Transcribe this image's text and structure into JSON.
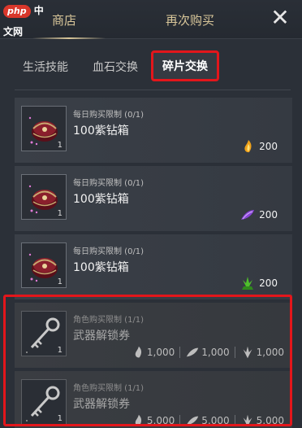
{
  "watermark": "php 中文网",
  "header": {
    "tab_shop": "商店",
    "tab_rebuy": "再次购买",
    "close": "✕"
  },
  "sub_tabs": {
    "life": "生活技能",
    "blood": "血石交换",
    "fragment": "碎片交换"
  },
  "items": [
    {
      "limit": "每日购买限制 (0/1)",
      "name": "100紫钻箱",
      "qty": "1",
      "cost": "200",
      "currency_icon": "gold-flame-icon"
    },
    {
      "limit": "每日购买限制 (0/1)",
      "name": "100紫钻箱",
      "qty": "1",
      "cost": "200",
      "currency_icon": "purple-feather-icon"
    },
    {
      "limit": "每日购买限制 (0/1)",
      "name": "100紫钻箱",
      "qty": "1",
      "cost": "200",
      "currency_icon": "green-leaf-icon"
    }
  ],
  "locked_items": [
    {
      "limit": "角色购买限制 (1/1)",
      "name": "武器解锁券",
      "qty": "1",
      "costs": [
        "1,000",
        "1,000",
        "1,000"
      ]
    },
    {
      "limit": "角色购买限制 (1/1)",
      "name": "武器解锁券",
      "qty": "1",
      "costs": [
        "5,000",
        "5,000",
        "5,000"
      ]
    }
  ],
  "colors": {
    "highlight_red": "#e3161b",
    "gold": "#d9c79a"
  }
}
